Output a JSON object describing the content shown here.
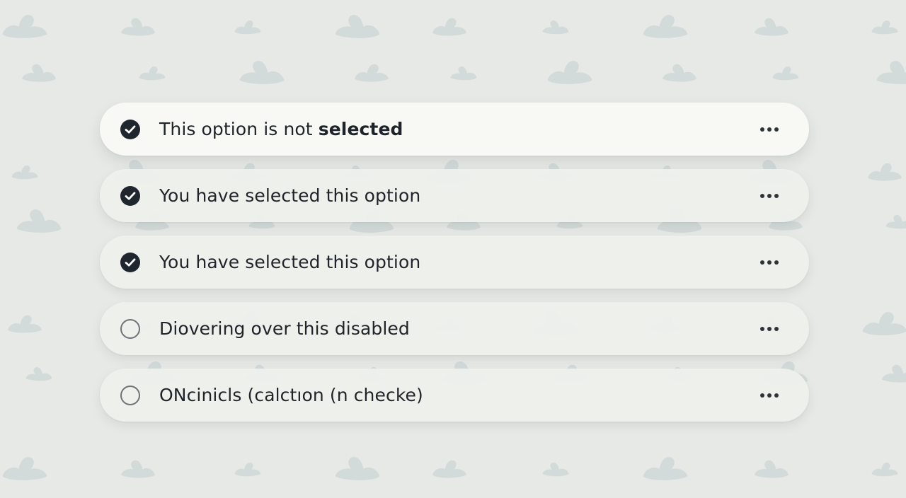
{
  "background": {
    "color": "#e7e9e6",
    "pattern_color": "#cdd5d6",
    "pattern_icon": "bird-silhouette-icon"
  },
  "options": [
    {
      "label": "This option is not",
      "label_emphasis": "selected",
      "state": "checked",
      "highlighted": true,
      "indicator_icon": "check-circle-icon",
      "menu_icon": "more-horizontal-icon"
    },
    {
      "label": "You have selected this option",
      "label_emphasis": "",
      "state": "checked",
      "highlighted": false,
      "indicator_icon": "check-circle-icon",
      "menu_icon": "more-horizontal-icon"
    },
    {
      "label": "You have selected this option",
      "label_emphasis": "",
      "state": "checked",
      "highlighted": false,
      "indicator_icon": "check-circle-icon",
      "menu_icon": "more-horizontal-icon"
    },
    {
      "label": "Diovering over this disabled",
      "label_emphasis": "",
      "state": "unchecked",
      "highlighted": false,
      "indicator_icon": "empty-circle-icon",
      "menu_icon": "more-horizontal-icon"
    },
    {
      "label": "ONcinicls (calctıon (n checke)",
      "label_emphasis": "",
      "state": "unchecked",
      "highlighted": false,
      "indicator_icon": "empty-circle-icon",
      "menu_icon": "more-horizontal-icon"
    }
  ],
  "colors": {
    "checked_fill": "#1f262d",
    "unchecked_border": "#6f7377",
    "text": "#1e2429",
    "row_highlight": "#f8f8f5",
    "row_default": "#eef0ec"
  }
}
